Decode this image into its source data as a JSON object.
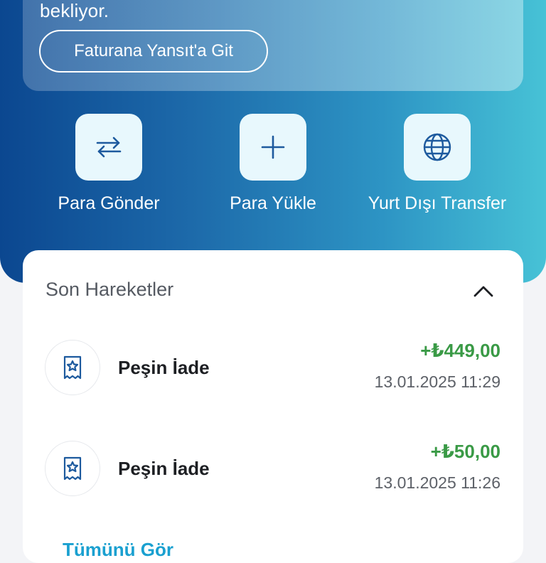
{
  "banner": {
    "text": "bekliyor.",
    "button_label": "Faturana Yansıt'a Git"
  },
  "actions": [
    {
      "label": "Para Gönder",
      "icon": "transfer-arrows-icon"
    },
    {
      "label": "Para Yükle",
      "icon": "plus-icon"
    },
    {
      "label": "Yurt Dışı Transfer",
      "icon": "globe-icon"
    }
  ],
  "transactions": {
    "title": "Son Hareketler",
    "collapse_icon": "chevron-up-icon",
    "items": [
      {
        "name": "Peşin İade",
        "amount": "+₺449,00",
        "date": "13.01.2025 11:29",
        "icon": "receipt-star-icon"
      },
      {
        "name": "Peşin İade",
        "amount": "+₺50,00",
        "date": "13.01.2025 11:26",
        "icon": "receipt-star-icon"
      }
    ],
    "more_link": "Tümünü Gör"
  },
  "colors": {
    "gradient_start": "#0b4790",
    "gradient_end": "#47c2d6",
    "amount_positive": "#3a9a46",
    "link": "#1aa0d0",
    "icon_blue": "#1d5a9e"
  }
}
